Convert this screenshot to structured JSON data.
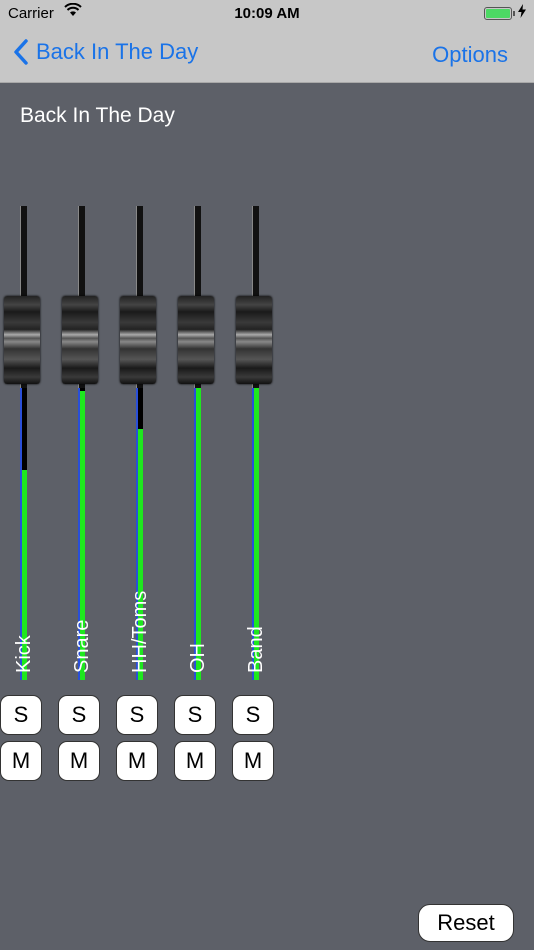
{
  "status": {
    "carrier": "Carrier",
    "time": "10:09 AM"
  },
  "nav": {
    "back_label": "Back In The Day",
    "options_label": "Options"
  },
  "page": {
    "title": "Back In The Day"
  },
  "channels": [
    {
      "name": "Kick",
      "level": 0.72,
      "solo": "S",
      "mute": "M"
    },
    {
      "name": "Snare",
      "level": 0.99,
      "solo": "S",
      "mute": "M"
    },
    {
      "name": "HH/Toms",
      "level": 0.86,
      "solo": "S",
      "mute": "M"
    },
    {
      "name": "OH",
      "level": 1.0,
      "solo": "S",
      "mute": "M"
    },
    {
      "name": "Band",
      "level": 1.0,
      "solo": "S",
      "mute": "M"
    }
  ],
  "footer": {
    "reset_label": "Reset"
  },
  "colors": {
    "meter": "#1ee81e",
    "accent": "#1a73e8",
    "background": "#5d6068"
  }
}
